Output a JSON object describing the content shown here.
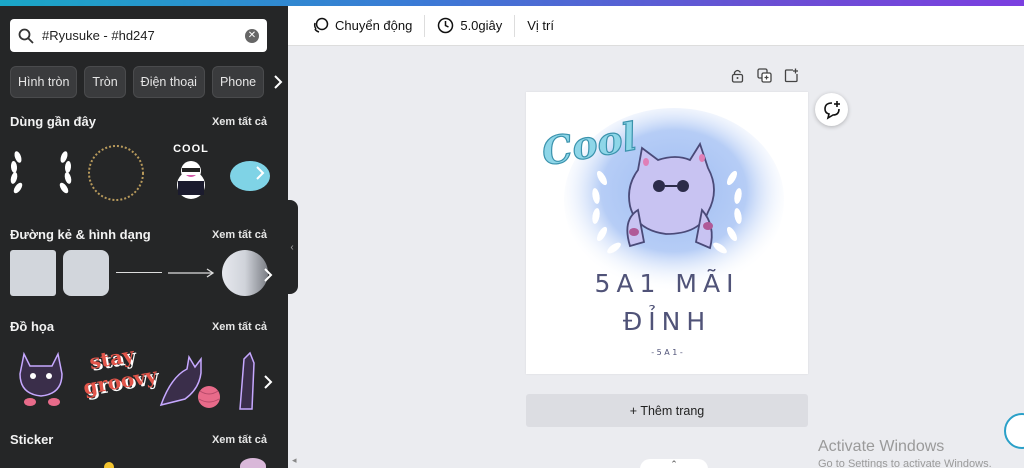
{
  "search": {
    "value": "#Ryusuke - #hd247"
  },
  "chips": [
    "Hình tròn",
    "Tròn",
    "Điện thoại",
    "Phone"
  ],
  "sections": {
    "recent": {
      "title": "Dùng gần đây",
      "see_all": "Xem tất cả"
    },
    "lines": {
      "title": "Đường kẻ & hình dạng",
      "see_all": "Xem tất cả"
    },
    "graphics": {
      "title": "Đồ họa",
      "see_all": "Xem tất cả"
    },
    "sticker": {
      "title": "Sticker",
      "see_all": "Xem tất cả"
    }
  },
  "toolbar": {
    "animate_label": "Chuyển động",
    "duration_label": "5.0giây",
    "position_label": "Vị trí"
  },
  "design": {
    "script_text": "Cool",
    "line1": "5A1 MÃI",
    "line2": "ĐỈNH",
    "sub": "- 5 A 1 -",
    "sticker_text": "COOL",
    "groovy_text1": "stay",
    "groovy_text2": "groovy"
  },
  "add_page_label": "+ Thêm trang",
  "watermark": {
    "line1": "Activate Windows",
    "line2": "Go to Settings to activate Windows."
  },
  "colors": {
    "panel": "#252627",
    "accent_purple": "#5b5a9e",
    "watercolor": "#a9c4f3"
  }
}
